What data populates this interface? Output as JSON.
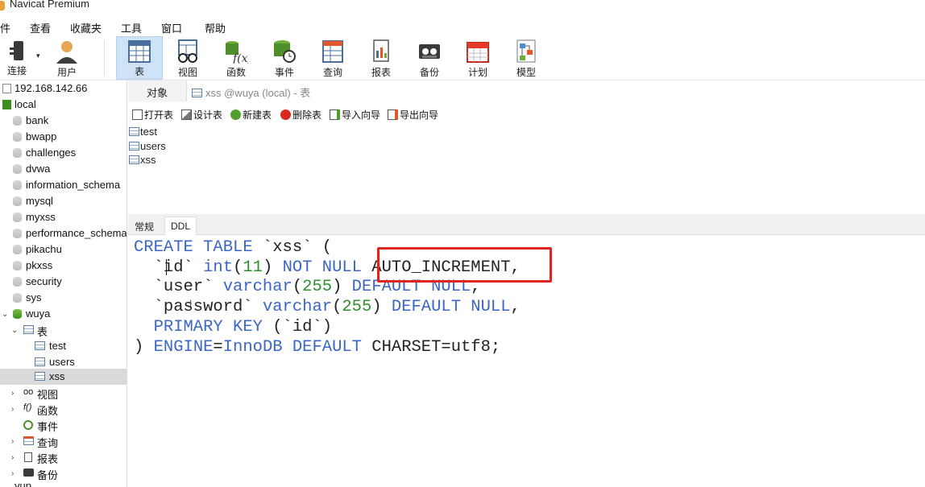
{
  "app": {
    "title": "Navicat Premium"
  },
  "menu": [
    "件",
    "查看",
    "收藏夹",
    "工具",
    "窗口",
    "帮助"
  ],
  "toolbar": [
    {
      "label": "连接",
      "icon": "plug-icon"
    },
    {
      "label": "用户",
      "icon": "user-icon"
    },
    {
      "label": "表",
      "icon": "table-icon",
      "active": true
    },
    {
      "label": "视图",
      "icon": "view-glasses-icon"
    },
    {
      "label": "函数",
      "icon": "function-icon"
    },
    {
      "label": "事件",
      "icon": "event-clock-icon"
    },
    {
      "label": "查询",
      "icon": "query-icon"
    },
    {
      "label": "报表",
      "icon": "report-icon"
    },
    {
      "label": "备份",
      "icon": "backup-icon"
    },
    {
      "label": "计划",
      "icon": "schedule-calendar-icon"
    },
    {
      "label": "模型",
      "icon": "model-icon"
    }
  ],
  "sidebar": {
    "connections": [
      {
        "label": "192.168.142.66"
      },
      {
        "label": "local"
      }
    ],
    "databases": [
      "bank",
      "bwapp",
      "challenges",
      "dvwa",
      "information_schema",
      "mysql",
      "myxss",
      "performance_schema",
      "pikachu",
      "pkxss",
      "security",
      "sys",
      "wuya"
    ],
    "wuya_children": {
      "tables_label": "表",
      "tables": [
        "test",
        "users",
        "xss"
      ],
      "selected_table": "xss",
      "others": [
        "视图",
        "函数",
        "事件",
        "查询",
        "报表",
        "备份"
      ]
    },
    "next_db_partial": "yup"
  },
  "tabs": {
    "object": "对象",
    "active": "xss @wuya (local) - 表"
  },
  "object_toolbar": [
    "打开表",
    "设计表",
    "新建表",
    "删除表",
    "导入向导",
    "导出向导"
  ],
  "object_list": [
    "test",
    "users",
    "xss"
  ],
  "subtabs": [
    "常规",
    "DDL"
  ],
  "ddl": {
    "line1_kw": "CREATE TABLE",
    "line1_rest": " `xss` (",
    "line2_a": "  `id` ",
    "line2_type": "int",
    "line2_p1": "(",
    "line2_num": "11",
    "line2_p2": ") ",
    "line2_kw": "NOT NULL",
    "line2_rest": " AUTO_INCREMENT,",
    "line3_a": "  `user` ",
    "line3_type": "varchar",
    "line3_p1": "(",
    "line3_num": "255",
    "line3_p2": ") ",
    "line3_kw": "DEFAULT NULL",
    "line3_rest": ",",
    "line4_a": "  `password` ",
    "line4_type": "varchar",
    "line4_p1": "(",
    "line4_num": "255",
    "line4_p2": ") ",
    "line4_kw": "DEFAULT NULL",
    "line4_rest": ",",
    "line5_kw": "  PRIMARY KEY",
    "line5_rest": " (`id`)",
    "line6_a": ") ",
    "line6_kw1": "ENGINE",
    "line6_eq": "=",
    "line6_kw2": "InnoDB",
    "line6_sp": " ",
    "line6_kw3": "DEFAULT",
    "line6_rest": " CHARSET=utf8;"
  },
  "colors": {
    "keyword": "#3a66c4",
    "number": "#2f8f2f",
    "highlight": "#e0241f",
    "selection": "#cfe3f7"
  }
}
